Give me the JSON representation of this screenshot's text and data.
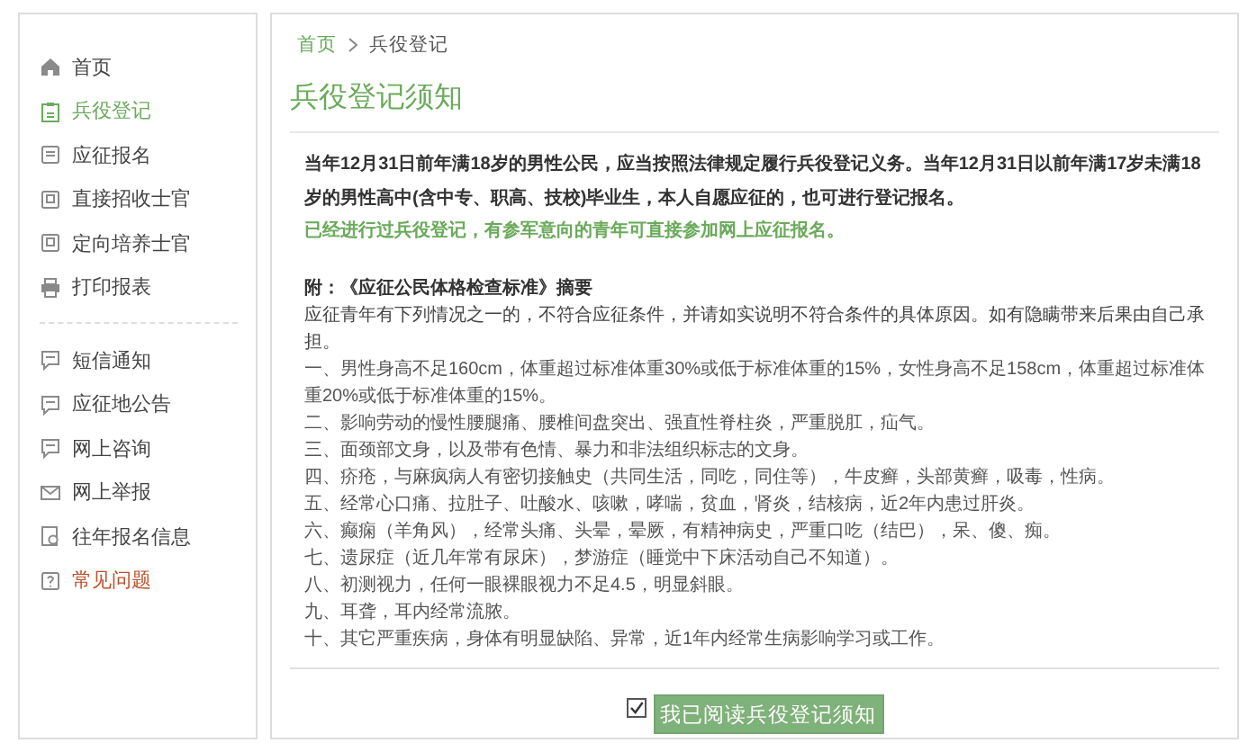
{
  "sidebar": {
    "groups": [
      {
        "items": [
          {
            "label": "首页",
            "selected": false,
            "kind": "normal"
          },
          {
            "label": "兵役登记",
            "selected": true,
            "kind": "normal"
          },
          {
            "label": "应征报名",
            "selected": false,
            "kind": "normal"
          },
          {
            "label": "直接招收士官",
            "selected": false,
            "kind": "normal"
          },
          {
            "label": "定向培养士官",
            "selected": false,
            "kind": "normal"
          },
          {
            "label": "打印报表",
            "selected": false,
            "kind": "normal"
          }
        ]
      },
      {
        "items": [
          {
            "label": "短信通知",
            "selected": false,
            "kind": "normal"
          },
          {
            "label": "应征地公告",
            "selected": false,
            "kind": "normal"
          },
          {
            "label": "网上咨询",
            "selected": false,
            "kind": "normal"
          },
          {
            "label": "网上举报",
            "selected": false,
            "kind": "normal"
          },
          {
            "label": "往年报名信息",
            "selected": false,
            "kind": "normal"
          },
          {
            "label": "常见问题",
            "selected": false,
            "kind": "alert"
          }
        ]
      }
    ]
  },
  "breadcrumb": [
    "首页",
    "兵役登记"
  ],
  "title": "兵役登记须知",
  "notice": "当年12月31日前年满18岁的男性公民，应当按照法律规定履行兵役登记义务。当年12月31日以前年满17岁未满18岁的男性高中(含中专、职高、技校)毕业生，本人自愿应征的，也可进行登记报名。",
  "note": "已经进行过兵役登记，有参军意向的青年可直接参加网上应征报名。",
  "standard": {
    "heading": "附：《应征公民体格检查标准》摘要",
    "intro": "应征青年有下列情况之一的，不符合应征条件，并请如实说明不符合条件的具体原因。如有隐瞒带来后果由自己承担。",
    "items": [
      "一、男性身高不足160cm，体重超过标准体重30%或低于标准体重的15%，女性身高不足158cm，体重超过标准体重20%或低于标准体重的15%。",
      "二、影响劳动的慢性腰腿痛、腰椎间盘突出、强直性脊柱炎，严重脱肛，疝气。",
      "三、面颈部文身，以及带有色情、暴力和非法组织标志的文身。",
      "四、疥疮，与麻疯病人有密切接触史（共同生活，同吃，同住等），牛皮癣，头部黄癣，吸毒，性病。",
      "五、经常心口痛、拉肚子、吐酸水、咳嗽，哮喘，贫血，肾炎，结核病，近2年内患过肝炎。",
      "六、癫痫（羊角风），经常头痛、头晕，晕厥，有精神病史，严重口吃（结巴），呆、傻、痴。",
      "七、遗尿症（近几年常有尿床），梦游症（睡觉中下床活动自己不知道）。",
      "八、初测视力，任何一眼裸眼视力不足4.5，明显斜眼。",
      "九、耳聋，耳内经常流脓。",
      "十、其它严重疾病，身体有明显缺陷、异常，近1年内经常生病影响学习或工作。"
    ]
  },
  "agree": {
    "checked": true,
    "button": "我已阅读兵役登记须知"
  }
}
